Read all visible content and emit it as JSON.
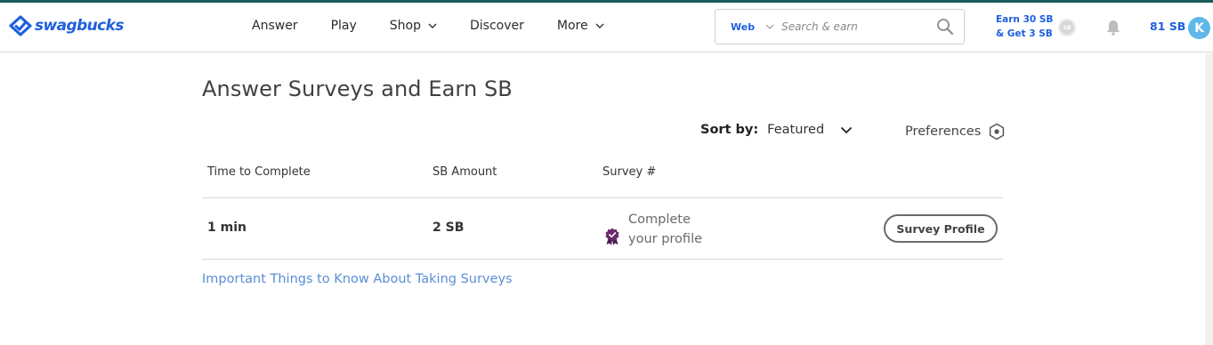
{
  "brand": {
    "logo_text": "swagbucks",
    "accent": "#1f5fe0",
    "top_line": "#1a5c5a"
  },
  "nav": {
    "items": [
      {
        "label": "Answer",
        "dropdown": false
      },
      {
        "label": "Play",
        "dropdown": false
      },
      {
        "label": "Shop",
        "dropdown": true
      },
      {
        "label": "Discover",
        "dropdown": false
      },
      {
        "label": "More",
        "dropdown": true
      }
    ]
  },
  "search": {
    "scope": "Web",
    "placeholder": "Search & earn",
    "icon": "search-icon"
  },
  "header_right": {
    "promo_line1": "Earn 30 SB",
    "promo_line2": "& Get 3 SB",
    "coin_text": "SB",
    "balance": "81 SB",
    "avatar_initial": "K"
  },
  "main": {
    "title": "Answer Surveys and Earn SB",
    "sort_label": "Sort by:",
    "sort_value": "Featured",
    "preferences_label": "Preferences",
    "columns": [
      "Time to Complete",
      "SB Amount",
      "Survey #"
    ],
    "rows": [
      {
        "time": "1 min",
        "amount": "2 SB",
        "survey_line1": "Complete",
        "survey_line2": "your profile",
        "action": "Survey Profile",
        "badge_color": "#6a2a6e"
      }
    ],
    "info_link": "Important Things to Know About Taking Surveys"
  }
}
